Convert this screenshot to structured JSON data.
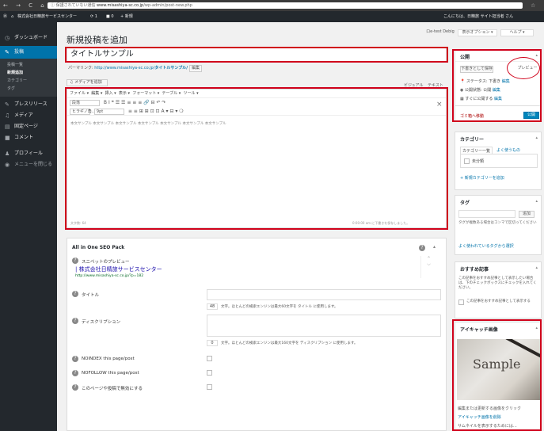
{
  "browser": {
    "nav": "← → C ⌂",
    "security": "ⓘ 保護されていない通信",
    "host": "www.misashiya-sc.co.jp",
    "path": "/wp-admin/post-new.php"
  },
  "adminbar": {
    "wp_icon": "Ⓦ",
    "home_icon": "⌂",
    "site_name": "株式会社日精旅サービスセンター",
    "updates": "⟳ 1",
    "comments": "■ 0",
    "new": "+ 新規",
    "greeting": "こんにちは、日精旅 サイト担当者 さん"
  },
  "sidebar": {
    "dashboard": "ダッシュボード",
    "posts": "投稿",
    "posts_all": "投稿一覧",
    "posts_new": "新規追加",
    "posts_category": "カテゴリー",
    "posts_tag": "タグ",
    "press": "プレスリリース",
    "media": "メディア",
    "pages": "固定ページ",
    "comments": "コメント",
    "profile": "プロフィール",
    "collapse": "メニューを閉じる"
  },
  "top_buttons": {
    "seo": "ロe-test Debig",
    "screen_options": "表示オプション ▾",
    "help": "ヘルプ ▾"
  },
  "page_title": "新規投稿を追加",
  "post_title": "タイトルサンプル",
  "permalink": {
    "label": "パーマリンク:",
    "url": "http://www.misashiya-sc.co.jp/",
    "slug": "タイトルサンプル/",
    "edit": "編集"
  },
  "editor": {
    "add_media": "メディアを追加",
    "tab_visual": "ビジュアル",
    "tab_text": "テキスト",
    "menubar": [
      "ファイル ▾",
      "編集 ▾",
      "挿入 ▾",
      "表示 ▾",
      "フォーマット ▾",
      "テーブル ▾",
      "ツール ▾"
    ],
    "toolbar1": "B  I  ❝  ☰  ☰  ≡  ≡  ≡  🔗  ⊟  ↶  ↷",
    "toolbar2": "≡  ≡  ⊞  ⊞  ⊡  ⊡  A ▾  ⊟ ▾  ❍",
    "format_select": "段落",
    "fontsize_select": "ヒラギノ角...",
    "fontpx_select": "9pt",
    "content": "本文サンプル 本文サンプル 本文サンプル 本文サンプル 本文サンプル 本文サンプル 本文サンプル",
    "close": "×",
    "status_left": "文字数: 64",
    "status_right": "0:00:00 am に下書きを保存しました。"
  },
  "seo": {
    "title": "All in One SEO Pack",
    "help_icon": "?",
    "snippet_label": "スニペットのプレビュー",
    "snippet_title": "| 株式会社日精旅サービスセンター",
    "snippet_url": "http://www.misashiya-sc.co.jp/?p=182",
    "title_label": "タイトル",
    "title_count": "48",
    "title_note": "文字。ほとんどの検索エンジンは最大60文字を タイトル に使用します。",
    "desc_label": "ディスクリプション",
    "desc_count": "0",
    "desc_note": "文字。ほとんどの検索エンジンは最大160文字を ディスクリプション に使用します。",
    "noindex": "NOINDEX this page/post",
    "nofollow": "NOFOLLOW this page/post",
    "disable": "このページや投稿で無効にする"
  },
  "publish": {
    "title": "公開",
    "save_draft": "下書きとして保存",
    "preview": "プレビュー",
    "status": "ステータス: 下書き",
    "visibility": "公開状態: 公開",
    "schedule": "すぐに公開する",
    "edit": "編集",
    "trash": "ゴミ箱へ移動",
    "publish": "公開"
  },
  "categories": {
    "title": "カテゴリー",
    "tab_all": "カテゴリー一覧",
    "tab_popular": "よく使うもの",
    "uncategorized": "未分類",
    "add_new": "+ 新規カテゴリーを追加"
  },
  "tags": {
    "title": "タグ",
    "add": "追加",
    "note": "タグが複数ある場合はコンマで区切ってください",
    "choose": "よく使われているタグから選択"
  },
  "recommend": {
    "title": "おすすめ記事",
    "desc": "この記事をおすすめ記事として表示したい場合は、下のチェックボックスにチェックを入れてください。",
    "label": "この記事をおすすめ記事として表示する"
  },
  "eyecatch": {
    "title": "アイキャッチ画像",
    "image_text": "Sample",
    "edit_note": "編集または更新する画像をクリック",
    "remove": "アイキャッチ画像を削除",
    "thumb_note": "サムネイルを表示するためには..."
  },
  "toggle_icon": "▴"
}
